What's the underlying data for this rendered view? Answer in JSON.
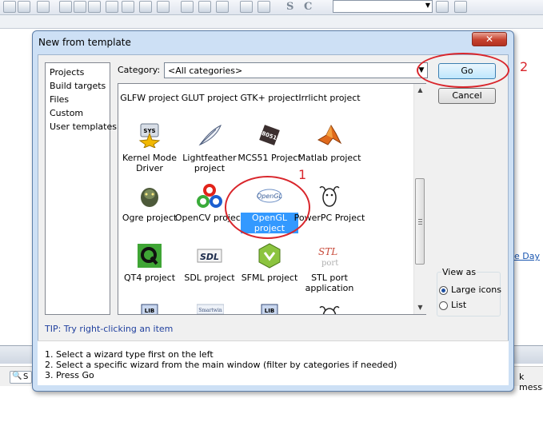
{
  "background": {
    "link_fragment": "e Day",
    "status_fragment": "k messa",
    "bottom_tab_fragment": "S"
  },
  "dialog": {
    "title": "New from template",
    "close_glyph": "✕",
    "left_list": [
      "Projects",
      "Build targets",
      "Files",
      "Custom",
      "User templates"
    ],
    "category_label": "Category:",
    "category_value": "<All categories>",
    "templates": {
      "row0": [
        "GLFW project",
        "GLUT project",
        "GTK+ project",
        "Irrlicht project"
      ],
      "row1": [
        "Kernel Mode Driver",
        "Lightfeather project",
        "MCS51 Project",
        "Matlab project"
      ],
      "row2": [
        "Ogre project",
        "OpenCV project",
        "OpenGL project",
        "PowerPC Project"
      ],
      "row3": [
        "QT4 project",
        "SDL project",
        "SFML project",
        "STL port application"
      ],
      "selected": "OpenGL project"
    },
    "icon_texts": {
      "sys": "SYS",
      "mcs51": "8051",
      "sdl": "SDL",
      "opengl": "OpenGL",
      "stl_top": "STL",
      "stl_bottom": "port",
      "lib": "LIB",
      "smartwin": "Smartwin"
    },
    "go_label": "Go",
    "cancel_label": "Cancel",
    "view_as": {
      "legend": "View as",
      "options": [
        "Large icons",
        "List"
      ],
      "selected": "Large icons"
    },
    "tip": "TIP: Try right-clicking an item",
    "instructions": [
      "1. Select a wizard type first on the left",
      "2. Select a specific wizard from the main window (filter by categories if needed)",
      "3. Press Go"
    ]
  },
  "annotations": {
    "label_1": "1",
    "label_2": "2"
  },
  "colors": {
    "annotation": "#d9262c",
    "selection": "#3399ff",
    "dialog_frame": "#cde0f5"
  }
}
